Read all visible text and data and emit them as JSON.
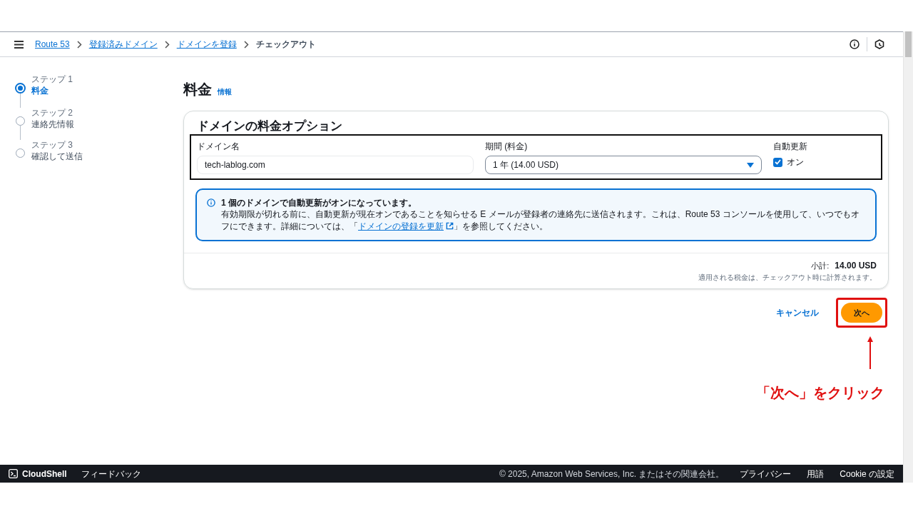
{
  "breadcrumbs": [
    {
      "label": "Route 53",
      "link": true
    },
    {
      "label": "登録済みドメイン",
      "link": true
    },
    {
      "label": "ドメインを登録",
      "link": true
    },
    {
      "label": "チェックアウト",
      "link": false
    }
  ],
  "steps": [
    {
      "step": "ステップ 1",
      "label": "料金",
      "selected": true
    },
    {
      "step": "ステップ 2",
      "label": "連絡先情報",
      "selected": false
    },
    {
      "step": "ステップ 3",
      "label": "確認して送信",
      "selected": false
    }
  ],
  "page": {
    "title": "料金",
    "info_link": "情報"
  },
  "panel": {
    "title": "ドメインの料金オプション",
    "domain": {
      "label": "ドメイン名",
      "value": "tech-lablog.com"
    },
    "period": {
      "label": "期間 (料金)",
      "value": "1 年 (14.00 USD)"
    },
    "auto_renew": {
      "label": "自動更新",
      "option": "オン",
      "checked": true
    },
    "alert": {
      "title": "1 個のドメインで自動更新がオンになっています。",
      "text_before": "有効期限が切れる前に、自動更新が現在オンであることを知らせる E メールが登録者の連絡先に送信されます。これは、Route 53 コンソールを使用して、いつでもオフにできます。詳細については、「",
      "link": "ドメインの登録を更新",
      "text_after": "」を参照してください。"
    },
    "subtotal_label": "小計:",
    "subtotal_value": "14.00 USD",
    "tax_note": "適用される税金は、チェックアウト時に計算されます。"
  },
  "actions": {
    "cancel": "キャンセル",
    "next": "次へ"
  },
  "annotation": {
    "text": "「次へ」をクリック"
  },
  "footer": {
    "cloudshell": "CloudShell",
    "feedback": "フィードバック",
    "copyright": "© 2025, Amazon Web Services, Inc. またはその関連会社。",
    "links": [
      "プライバシー",
      "用語",
      "Cookie の設定"
    ]
  }
}
